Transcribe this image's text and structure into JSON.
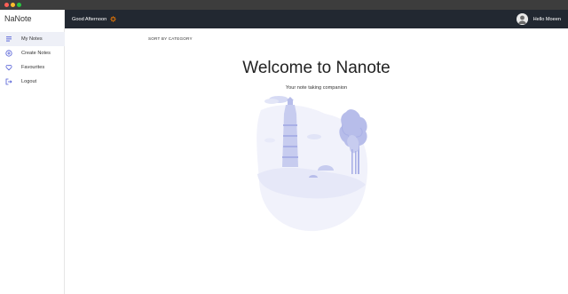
{
  "app": {
    "name": "NaNote"
  },
  "sidebar": {
    "items": [
      {
        "label": "My Notes",
        "icon": "notes-list-icon",
        "active": true
      },
      {
        "label": "Create Notes",
        "icon": "plus-circle-icon",
        "active": false
      },
      {
        "label": "Favourites",
        "icon": "heart-icon",
        "active": false
      },
      {
        "label": "Logout",
        "icon": "logout-icon",
        "active": false
      }
    ]
  },
  "header": {
    "greeting": "Good Afternoon",
    "greeting_icon": "sun-icon",
    "user_greeting": "Hello Moeen"
  },
  "main": {
    "sort_label": "SORT BY CATEGORY",
    "welcome_title": "Welcome to Nanote",
    "tagline": "Your note taking companion"
  },
  "colors": {
    "topbar": "#222831",
    "accent": "#4f5bd5",
    "sun": "#f57c00",
    "illustration": "#c7ccef"
  }
}
